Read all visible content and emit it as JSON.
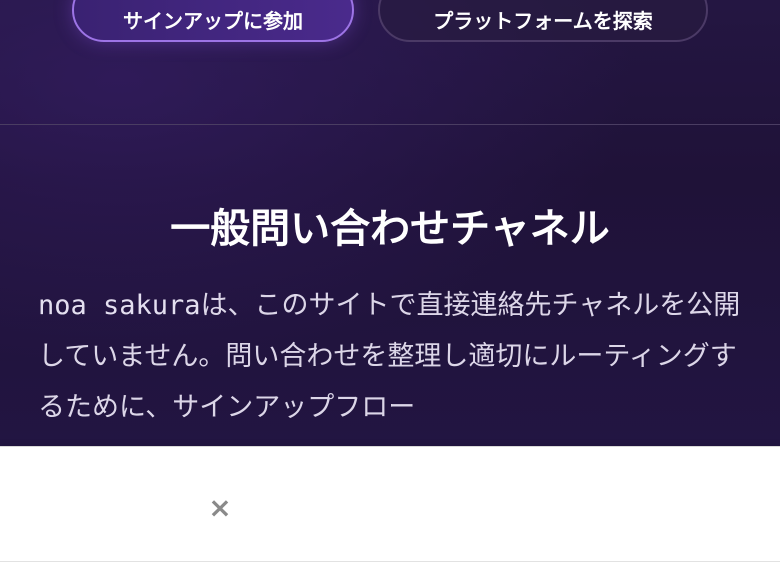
{
  "hero": {
    "buttons": {
      "signup_label": "サインアップに参加",
      "explore_label": "プラットフォームを探索"
    },
    "section": {
      "title": "一般問い合わせチャネル",
      "body_name": "noa sakura",
      "body_text": "は、このサイトで直接連絡先チャネルを公開していません。問い合わせを整理し適切にルーティングするために、サインアップフロー"
    }
  },
  "overlay": {
    "close_icon": "close-icon",
    "close_glyph": "×"
  },
  "colors": {
    "hero_bg": "#221542",
    "primary_border": "#9d74e6",
    "secondary_border": "#4b3a66",
    "title_text": "#ffffff",
    "body_text": "#dcd6e8",
    "overlay_bg": "#ffffff",
    "close_icon": "#8a8a8a"
  }
}
